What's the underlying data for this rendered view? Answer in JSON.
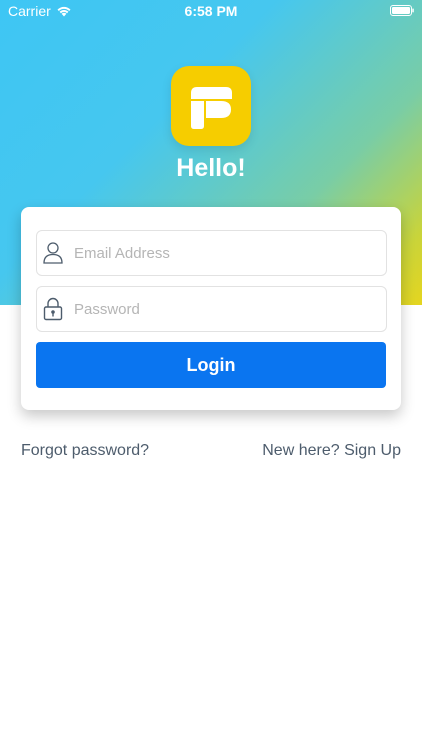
{
  "status_bar": {
    "carrier": "Carrier",
    "time": "6:58 PM"
  },
  "header": {
    "title": "Hello!"
  },
  "login_form": {
    "email_placeholder": "Email Address",
    "password_placeholder": "Password",
    "login_label": "Login"
  },
  "links": {
    "forgot_password": "Forgot password?",
    "sign_up": "New here? Sign Up"
  },
  "colors": {
    "primary": "#0a75f0",
    "logo_yellow": "#f6cd00",
    "gradient_start": "#3ec6f4",
    "gradient_end": "#e5d51f",
    "link_text": "#4d5c6c"
  }
}
